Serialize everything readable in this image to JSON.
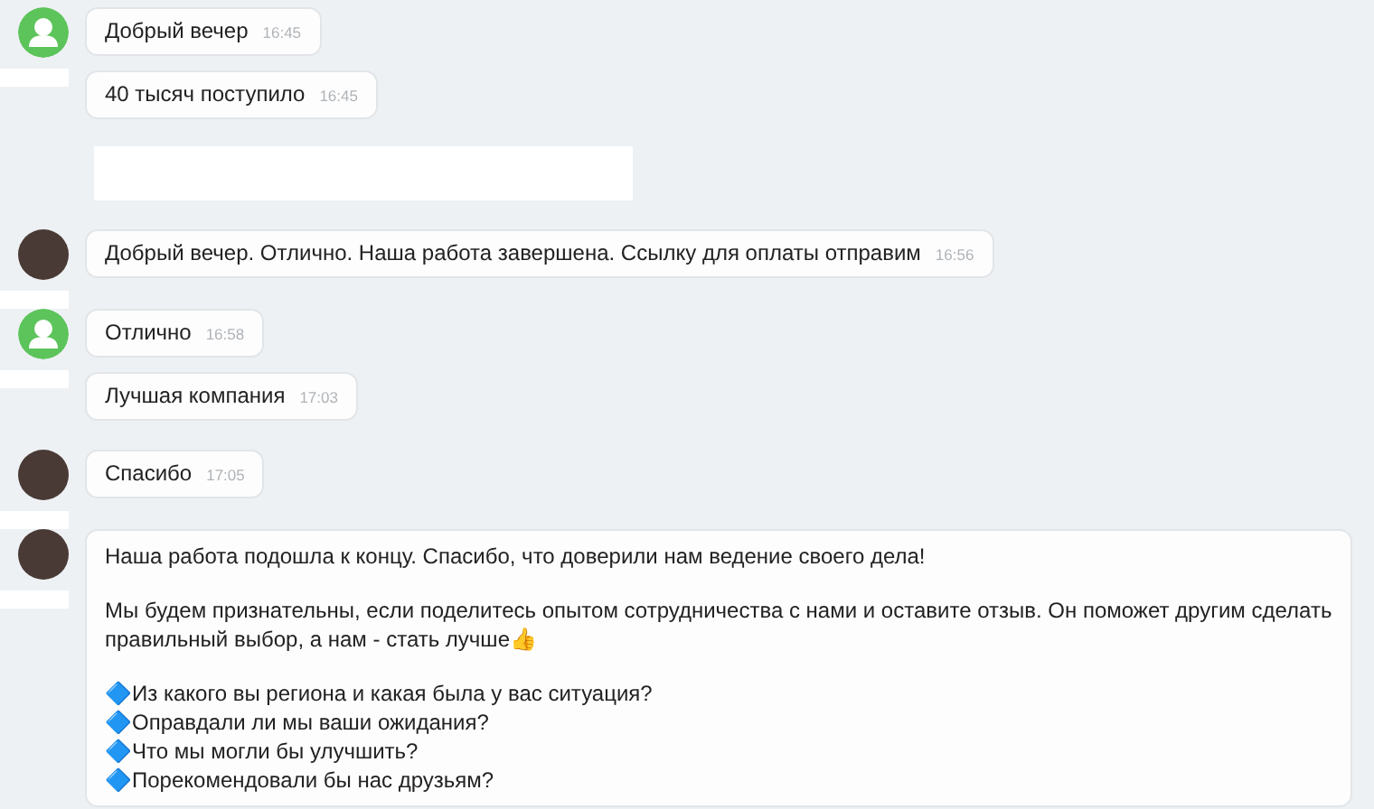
{
  "feed": [
    {
      "kind": "group",
      "photo_avatar": false,
      "messages": [
        {
          "text": "Добрый вечер",
          "time": "16:45"
        },
        {
          "text": "40 тысяч поступило",
          "time": "16:45"
        }
      ]
    },
    {
      "kind": "blank"
    },
    {
      "kind": "group",
      "photo_avatar": true,
      "messages": [
        {
          "text": "Добрый вечер. Отлично. Наша работа завершена. Ссылку для оплаты отправим",
          "time": "16:56"
        }
      ]
    },
    {
      "kind": "group",
      "photo_avatar": false,
      "messages": [
        {
          "text": "Отлично",
          "time": "16:58"
        },
        {
          "text": "Лучшая компания",
          "time": "17:03"
        }
      ]
    },
    {
      "kind": "group",
      "photo_avatar": true,
      "messages": [
        {
          "text": "Спасибо",
          "time": "17:05"
        }
      ]
    },
    {
      "kind": "group",
      "photo_avatar": true,
      "messages": [
        {
          "paragraphs": [
            [
              "Наша работа подошла к концу. Спасибо, что доверили нам ведение своего дела!"
            ],
            [
              "Мы будем признательны, если поделитесь опытом сотрудничества с нами и оставите отзыв. Он поможет другим сделать правильный выбор, а нам - стать лучше👍"
            ],
            [
              "🔷Из какого вы региона и какая была у вас ситуация?",
              "🔷Оправдали ли мы ваши ожидания?",
              "🔷Что мы могли бы улучшить?",
              "🔷Порекомендовали бы нас друзьям?"
            ]
          ]
        }
      ]
    }
  ]
}
